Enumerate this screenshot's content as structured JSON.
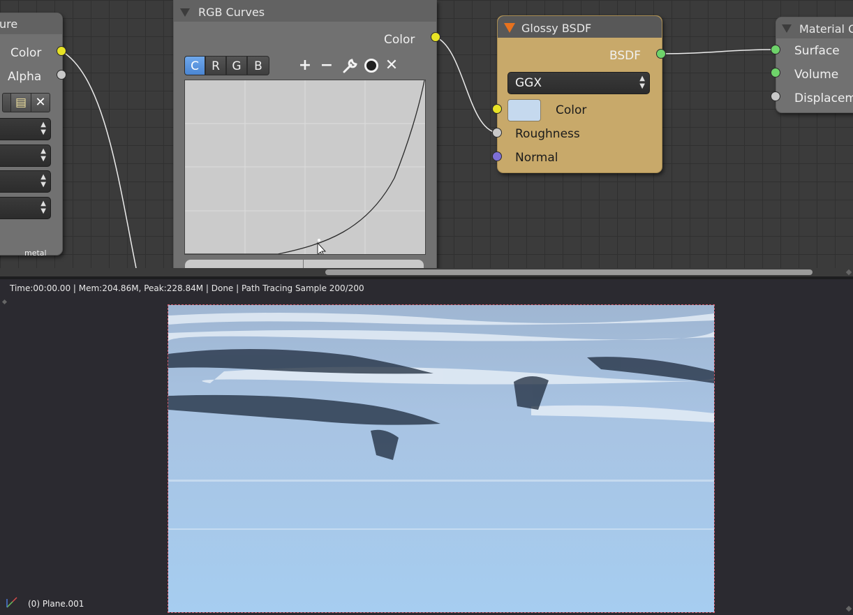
{
  "node_editor": {
    "texture_node": {
      "title_fragment": "ure",
      "outputs": [
        "Color",
        "Alpha"
      ],
      "footer": "metal"
    },
    "rgb_curves_node": {
      "title": "RGB Curves",
      "output": "Color",
      "channels": [
        "C",
        "R",
        "G",
        "B"
      ],
      "active_channel": "C",
      "tools": {
        "add": "+",
        "remove": "−",
        "settings": "wrench",
        "reset": "●",
        "delete": "✕"
      }
    },
    "glossy_node": {
      "title": "Glossy BSDF",
      "output": "BSDF",
      "distribution": "GGX",
      "inputs": [
        "Color",
        "Roughness",
        "Normal"
      ],
      "color_swatch": "#c5d9ee",
      "header_color": "#c8a96a"
    },
    "material_output_node": {
      "title_fragment": "Material O",
      "inputs": [
        "Surface",
        "Volume",
        "Displacem"
      ]
    }
  },
  "status_bar": {
    "text": "Time:00:00.00 | Mem:204.86M, Peak:228.84M | Done | Path Tracing Sample 200/200"
  },
  "render_view": {
    "object_label": "(0) Plane.001"
  }
}
